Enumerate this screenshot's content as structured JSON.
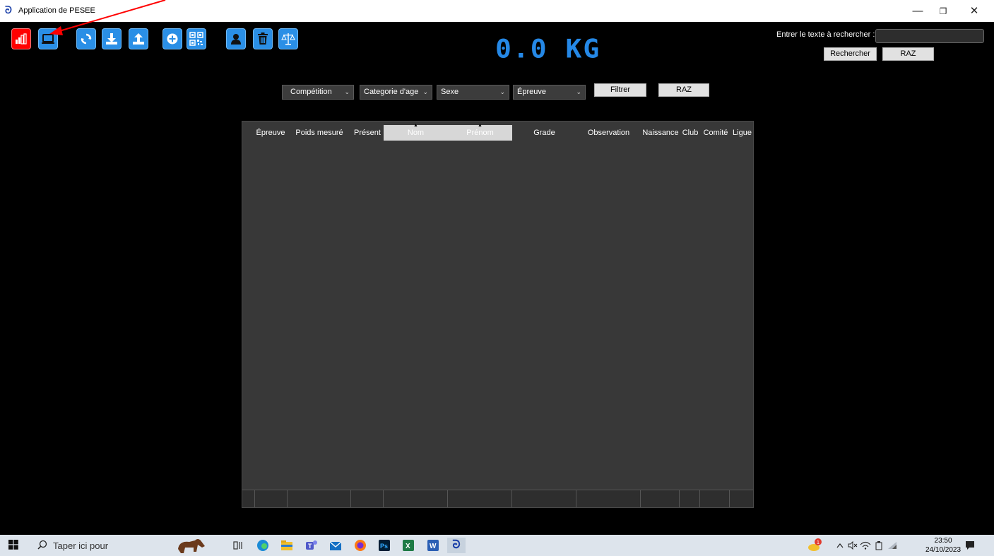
{
  "window": {
    "title": "Application de PESEE",
    "app_icon_glyph": "ᘒ",
    "minimize_glyph": "—",
    "maximize_glyph": "❐",
    "close_glyph": "✕"
  },
  "toolbar": {
    "buttons": [
      {
        "name": "stats-icon",
        "color": "#ff0000"
      },
      {
        "name": "laptop-icon",
        "color": "#2a8fe6"
      },
      {
        "name": "refresh-icon",
        "color": "#2a8fe6"
      },
      {
        "name": "download-icon",
        "color": "#2a8fe6"
      },
      {
        "name": "upload-icon",
        "color": "#2a8fe6"
      },
      {
        "name": "add-icon",
        "color": "#2a8fe6"
      },
      {
        "name": "qr-code-icon",
        "color": "#2a8fe6"
      },
      {
        "name": "user-icon",
        "color": "#2a8fe6"
      },
      {
        "name": "trash-icon",
        "color": "#2a8fe6"
      },
      {
        "name": "scale-icon",
        "color": "#2a8fe6"
      }
    ]
  },
  "weight_display": "0.0 KG",
  "search": {
    "label": "Entrer le texte à rechercher :",
    "value": "",
    "search_button": "Rechercher",
    "reset_button": "RAZ"
  },
  "filters": {
    "competition": "Compétition",
    "age_category": "Categorie d'age",
    "sex": "Sexe",
    "event": "Épreuve",
    "filter_button": "Filtrer",
    "reset_button": "RAZ"
  },
  "grid": {
    "columns": [
      "Épreuve",
      "Poids mesuré",
      "Présent",
      "Nom",
      "Prénom",
      "Grade",
      "Observation",
      "Naissance",
      "Club",
      "Comité",
      "Ligue"
    ],
    "sort_arrow": "▲",
    "rows": []
  },
  "taskbar": {
    "search_placeholder": "Taper ici pour",
    "time": "23:50",
    "date": "24/10/2023",
    "weather_badge": "1"
  },
  "colors": {
    "accent": "#2588e6",
    "annotation_arrow": "#ff0000"
  }
}
